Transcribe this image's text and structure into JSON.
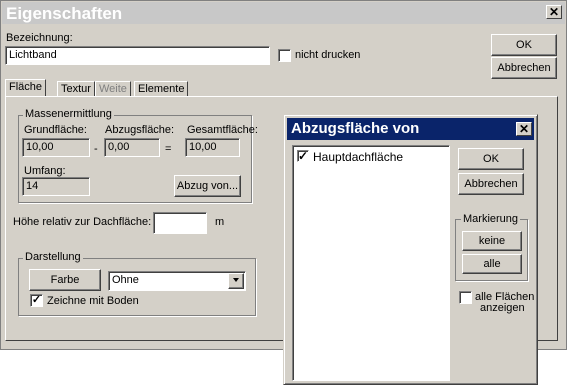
{
  "window": {
    "title": "Eigenschaften",
    "close_symbol": "✕"
  },
  "form": {
    "bezeichnung_label": "Bezeichnung:",
    "bezeichnung_value": "Lichtband",
    "nicht_drucken_label": "nicht drucken",
    "ok_label": "OK",
    "abbrechen_label": "Abbrechen"
  },
  "tabs": [
    {
      "label": "Fläche"
    },
    {
      "label": "Textur"
    },
    {
      "label": "Weite"
    },
    {
      "label": "Elemente"
    }
  ],
  "massen": {
    "group_title": "Massenermittlung",
    "grund_label": "Grundfläche:",
    "grund_value": "10,00",
    "minus": "-",
    "abzug_label": "Abzugsfläche:",
    "abzug_value": "0,00",
    "equals": "=",
    "gesamt_label": "Gesamtfläche:",
    "gesamt_value": "10,00",
    "umfang_label": "Umfang:",
    "umfang_value": "14",
    "abzug_button": "Abzug von..."
  },
  "hoehe": {
    "label": "Höhe relativ zur Dachfläche:",
    "value": "",
    "unit": "m"
  },
  "darstellung": {
    "group_title": "Darstellung",
    "farbe_button": "Farbe",
    "select_value": "Ohne",
    "zeichne_label": "Zeichne mit Boden",
    "zeichne_checked": "✓"
  },
  "dialog": {
    "title": "Abzugsfläche von",
    "close_symbol": "✕",
    "list_items": [
      {
        "label": "Hauptdachfläche",
        "checked": "✓"
      }
    ],
    "ok_label": "OK",
    "abbrechen_label": "Abbrechen",
    "markierung_title": "Markierung",
    "keine_label": "keine",
    "alle_label": "alle",
    "alle_flaechen_line1": "alle Flächen",
    "alle_flaechen_line2": "anzeigen"
  }
}
